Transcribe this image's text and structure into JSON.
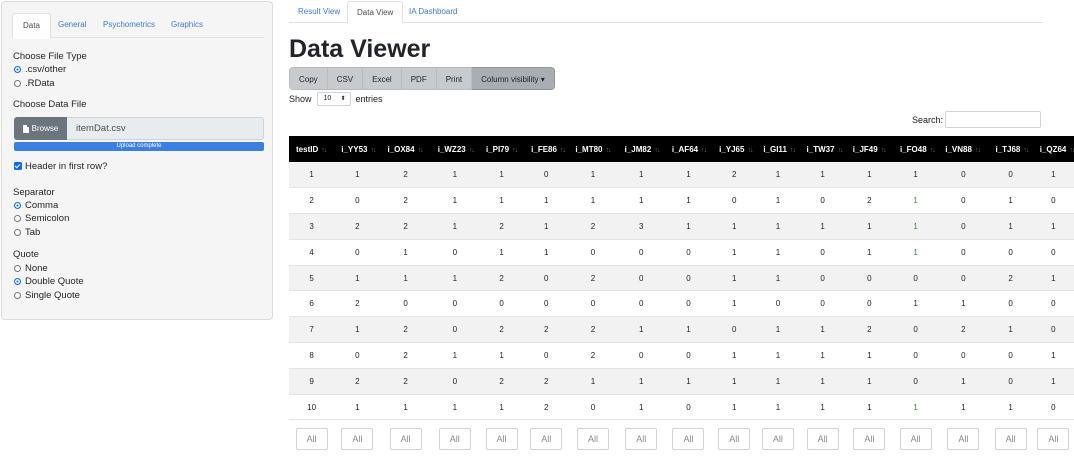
{
  "sidebar": {
    "tabs": [
      "Data",
      "General",
      "Psychometrics",
      "Graphics"
    ],
    "file_type": {
      "label": "Choose File Type",
      "options": [
        ".csv/other",
        ".RData"
      ],
      "selected": 0
    },
    "data_file": {
      "label": "Choose Data File",
      "browse_label": "Browse",
      "file_name": "itemDat.csv",
      "progress_text": "Upload complete",
      "progress": 1.0
    },
    "header_row": {
      "label": "Header in first row?",
      "checked": true
    },
    "separator": {
      "label": "Separator",
      "options": [
        "Comma",
        "Semicolon",
        "Tab"
      ],
      "selected": 0
    },
    "quote": {
      "label": "Quote",
      "options": [
        "None",
        "Double Quote",
        "Single Quote"
      ],
      "selected": 1
    }
  },
  "main": {
    "tabs": [
      "Result View",
      "Data View",
      "IA Dashboard"
    ],
    "active_tab": 1,
    "title": "Data Viewer",
    "buttons": [
      "Copy",
      "CSV",
      "Excel",
      "PDF",
      "Print",
      "Column visibility ▾"
    ],
    "show_label": "Show",
    "page_length": "10",
    "entries_label": "entries",
    "search_label": "Search:",
    "filter_placeholder": "All"
  },
  "table": {
    "columns": [
      "testID",
      "i_YY53",
      "i_OX84",
      "i_WZ23",
      "i_PI79",
      "i_FE86",
      "i_MT80",
      "i_JM82",
      "i_AF64",
      "i_YJ65",
      "i_GI11",
      "i_TW37",
      "i_JF49",
      "i_FO48",
      "i_VN88",
      "i_TJ68",
      "i_QZ64"
    ],
    "rows": [
      [
        "1",
        "1",
        "2",
        "1",
        "1",
        "0",
        "1",
        "1",
        "1",
        "2",
        "1",
        "1",
        "1",
        "1",
        "0",
        "0",
        "1"
      ],
      [
        "2",
        "0",
        "2",
        "1",
        "1",
        "1",
        "1",
        "1",
        "1",
        "0",
        "1",
        "0",
        "2",
        "1",
        "0",
        "1",
        "0"
      ],
      [
        "3",
        "2",
        "2",
        "1",
        "2",
        "1",
        "2",
        "3",
        "1",
        "1",
        "1",
        "1",
        "1",
        "1",
        "0",
        "1",
        "1"
      ],
      [
        "4",
        "0",
        "1",
        "0",
        "1",
        "1",
        "0",
        "0",
        "0",
        "1",
        "1",
        "0",
        "1",
        "1",
        "0",
        "0",
        "0"
      ],
      [
        "5",
        "1",
        "1",
        "1",
        "2",
        "0",
        "2",
        "0",
        "0",
        "1",
        "1",
        "0",
        "0",
        "0",
        "0",
        "2",
        "1"
      ],
      [
        "6",
        "2",
        "0",
        "0",
        "0",
        "0",
        "0",
        "0",
        "0",
        "1",
        "0",
        "0",
        "0",
        "1",
        "1",
        "0",
        "0"
      ],
      [
        "7",
        "1",
        "2",
        "0",
        "2",
        "2",
        "2",
        "1",
        "1",
        "0",
        "1",
        "1",
        "2",
        "0",
        "2",
        "1",
        "0"
      ],
      [
        "8",
        "0",
        "2",
        "1",
        "1",
        "0",
        "2",
        "0",
        "0",
        "1",
        "1",
        "1",
        "1",
        "0",
        "0",
        "0",
        "1"
      ],
      [
        "9",
        "2",
        "2",
        "0",
        "2",
        "2",
        "1",
        "1",
        "1",
        "1",
        "1",
        "1",
        "1",
        "0",
        "1",
        "0",
        "1"
      ],
      [
        "10",
        "1",
        "1",
        "1",
        "1",
        "2",
        "0",
        "1",
        "0",
        "1",
        "1",
        "1",
        "1",
        "1",
        "1",
        "1",
        "0"
      ]
    ]
  }
}
